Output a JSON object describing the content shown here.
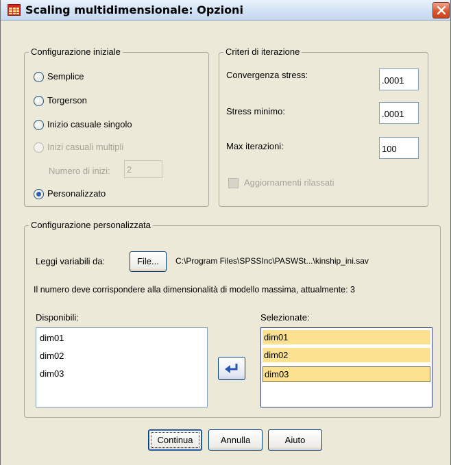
{
  "window": {
    "title": "Scaling multidimensionale: Opzioni"
  },
  "initial_config": {
    "legend": "Configurazione iniziale",
    "options": [
      {
        "label": "Semplice",
        "checked": false,
        "enabled": true
      },
      {
        "label": "Torgerson",
        "checked": false,
        "enabled": true
      },
      {
        "label": "Inizio casuale singolo",
        "checked": false,
        "enabled": true
      },
      {
        "label": "Inizi casuali multipli",
        "checked": false,
        "enabled": false
      },
      {
        "label": "Personalizzato",
        "checked": true,
        "enabled": true
      }
    ],
    "num_starts_label": "Numero di inizi:",
    "num_starts_value": "2"
  },
  "iteration": {
    "legend": "Criteri di iterazione",
    "convergence_label": "Convergenza stress:",
    "convergence_value": ".0001",
    "min_stress_label": "Stress minimo:",
    "min_stress_value": ".0001",
    "max_iter_label": "Max iterazioni:",
    "max_iter_value": "100",
    "relaxed_label": "Aggiornamenti rilassati"
  },
  "custom_config": {
    "legend": "Configurazione personalizzata",
    "read_label": "Leggi variabili da:",
    "file_button": "File...",
    "file_path": "C:\\Program Files\\SPSSInc\\PASWSt...\\kinship_ini.sav",
    "note": "Il numero deve corrispondere alla dimensionalità di modello massima, attualmente: 3",
    "available_label": "Disponibili:",
    "available_items": [
      "dim01",
      "dim02",
      "dim03"
    ],
    "selected_label": "Selezionate:",
    "selected_items": [
      "dim01",
      "dim02",
      "dim03"
    ]
  },
  "buttons": {
    "continue": "Continua",
    "cancel": "Annulla",
    "help": "Aiuto"
  }
}
